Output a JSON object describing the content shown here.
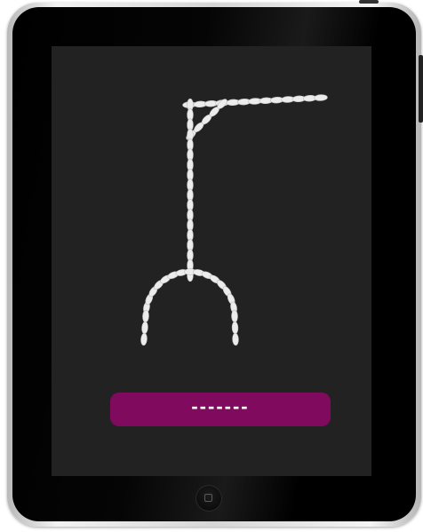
{
  "game": {
    "word_mask": "-------",
    "colors": {
      "screen": "#222222",
      "rope": "#ececec",
      "word_bar": "#7f0a5e",
      "word_text": "#ffffff"
    },
    "stage_parts_shown": [
      "beam",
      "brace",
      "post",
      "base-arch"
    ]
  }
}
